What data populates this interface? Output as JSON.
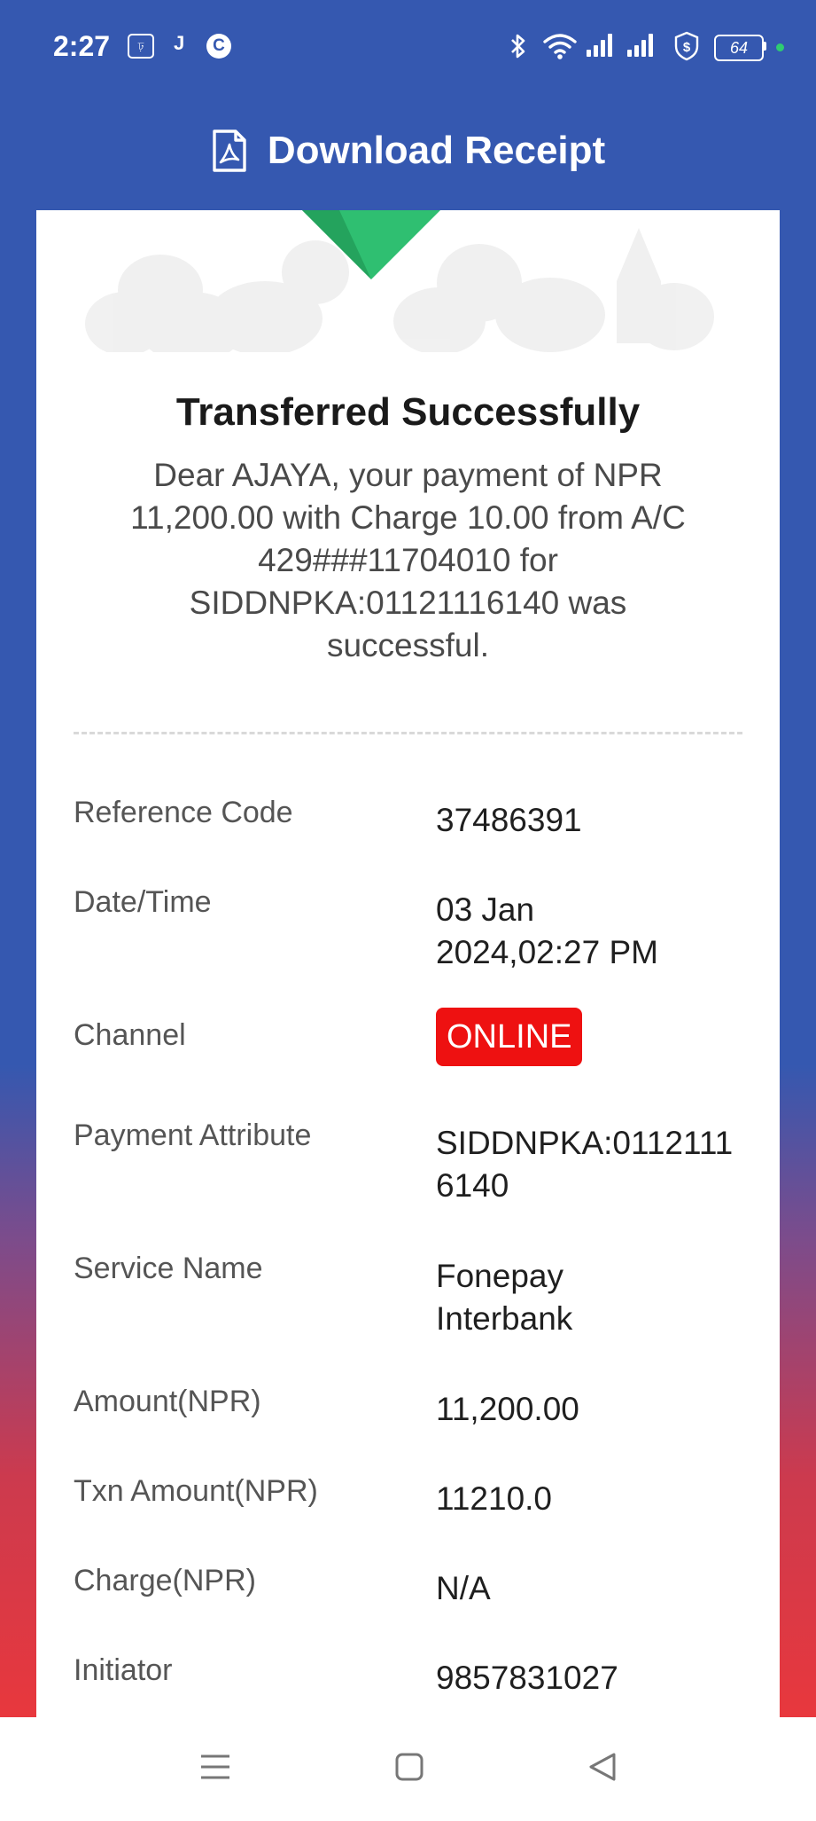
{
  "status_bar": {
    "time": "2:27",
    "icons": [
      "notification-box-icon",
      "j-icon",
      "c-circle-icon",
      "bluetooth-icon",
      "wifi-icon",
      "signal-icon",
      "signal-icon",
      "shield-dollar-icon"
    ],
    "j_letter": "J",
    "c_letter": "C",
    "battery": "64",
    "dot_color": "#2ecc71"
  },
  "header": {
    "title": "Download Receipt",
    "icon": "pdf-file-icon"
  },
  "receipt": {
    "title": "Transferred Successfully",
    "message": "Dear AJAYA, your payment of NPR 11,200.00 with Charge 10.00 from A/C 429###11704010 for SIDDNPKA:01121116140 was successful.",
    "details": {
      "reference_code_label": "Reference Code",
      "reference_code": "37486391",
      "datetime_label": "Date/Time",
      "datetime": "03 Jan 2024,02:27 PM",
      "channel_label": "Channel",
      "channel": "ONLINE",
      "payment_attribute_label": "Payment Attribute",
      "payment_attribute": "SIDDNPKA:01121116140",
      "service_name_label": "Service Name",
      "service_name": "Fonepay Interbank",
      "amount_label": "Amount(NPR)",
      "amount": "11,200.00",
      "txn_amount_label": "Txn Amount(NPR)",
      "txn_amount": "11210.0",
      "charge_label": "Charge(NPR)",
      "charge": "N/A",
      "initiator_label": "Initiator",
      "initiator": "9857831027"
    }
  },
  "colors": {
    "header_blue": "#3558b0",
    "gradient_red": "#e8383d",
    "success_green": "#2fbf71",
    "badge_red": "#ee1111"
  },
  "navbar": {
    "icons": [
      "menu-icon",
      "home-square-icon",
      "back-triangle-icon"
    ]
  }
}
